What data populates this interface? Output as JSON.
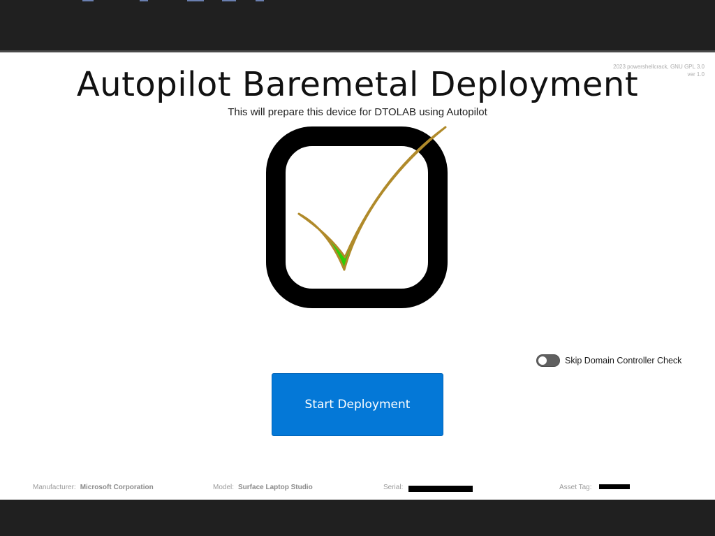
{
  "app": {
    "credits_line1": "2023 powershellcrack, GNU GPL 3.0",
    "credits_line2": "ver 1.0",
    "title": "Autopilot Baremetal Deployment",
    "subtitle": "This will prepare this device for DTOLAB using Autopilot",
    "logo_icon": "checkbox-checkmark-icon"
  },
  "colors": {
    "accent_button": "#0478d7",
    "check_green": "#33dd11",
    "check_outline": "#b08a2a",
    "toggle_off": "#606060",
    "frame_dark": "#202020"
  },
  "options": {
    "skip_dc_check_label": "Skip Domain Controller Check",
    "skip_dc_check_enabled": false
  },
  "actions": {
    "start_label": "Start Deployment"
  },
  "device": {
    "manufacturer_label": "Manufacturer:",
    "manufacturer_value": "Microsoft Corporation",
    "model_label": "Model:",
    "model_value": "Surface Laptop Studio",
    "serial_label": "Serial:",
    "asset_tag_label": "Asset Tag:"
  }
}
